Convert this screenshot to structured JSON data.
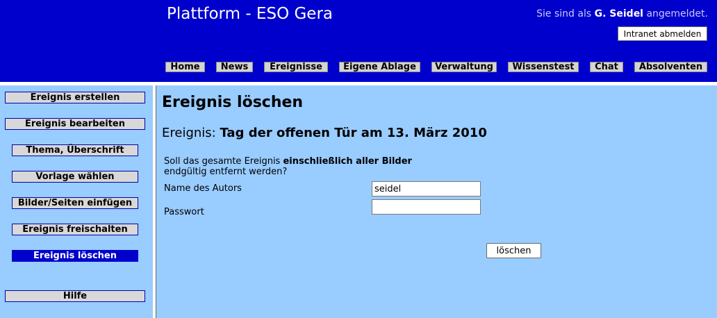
{
  "header": {
    "site_title": "Plattform - ESO Gera",
    "login_prefix": "Sie sind als",
    "user_name": "G. Seidel",
    "login_suffix": "angemeldet.",
    "logout_label": "Intranet abmelden"
  },
  "nav": [
    "Home",
    "News",
    "Ereignisse",
    "Eigene Ablage",
    "Verwaltung",
    "Wissenstest",
    "Chat",
    "Absolventen"
  ],
  "sidebar": {
    "items": [
      {
        "label": "Ereignis erstellen",
        "active": false
      },
      {
        "label": "Ereignis bearbeiten",
        "active": false
      },
      {
        "label": "Thema, Überschrift",
        "active": false
      },
      {
        "label": "Vorlage wählen",
        "active": false
      },
      {
        "label": "Bilder/Seiten einfügen",
        "active": false
      },
      {
        "label": "Ereignis freischalten",
        "active": false
      },
      {
        "label": "Ereignis löschen",
        "active": true
      },
      {
        "label": "Hilfe",
        "active": false
      }
    ]
  },
  "main": {
    "title": "Ereignis löschen",
    "event_prefix": "Ereignis:",
    "event_name": "Tag der offenen Tür am 13. März 2010",
    "question_part1": "Soll das gesamte Ereignis",
    "question_bold": "einschließlich aller Bilder",
    "question_part2": "endgültig entfernt werden?",
    "author_label": "Name des Autors",
    "author_value": "seidel",
    "password_label": "Passwort",
    "password_value": "",
    "delete_label": "löschen"
  },
  "colors": {
    "header_bg": "#0000cc",
    "page_bg": "#99ccff",
    "active_item_bg": "#0000cc"
  }
}
